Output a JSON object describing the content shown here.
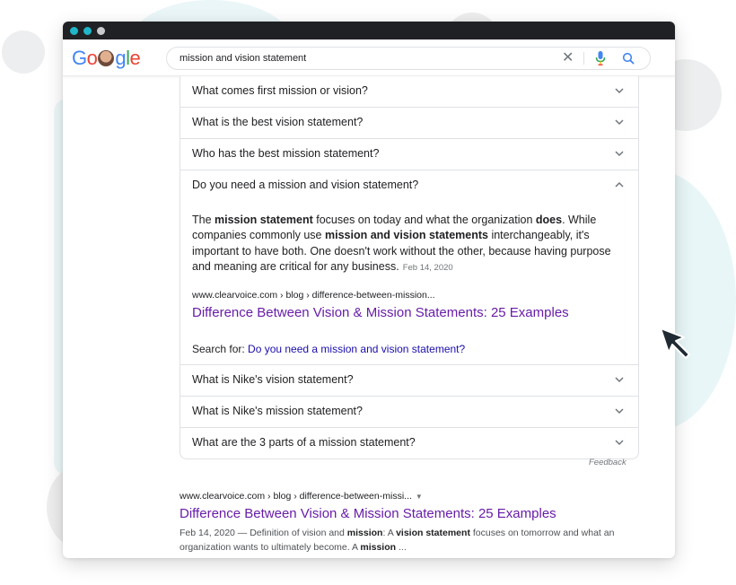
{
  "browser": {
    "logo_text": "Google"
  },
  "search": {
    "query": "mission and vision statement"
  },
  "paa": {
    "questions_before": [
      "What comes first mission or vision?",
      "What is the best vision statement?",
      "Who has the best mission statement?"
    ],
    "expanded": {
      "question": "Do you need a mission and vision statement?",
      "answer_parts": {
        "p1": "The ",
        "b1": "mission statement",
        "p2": " focuses on today and what the organization ",
        "b2": "does",
        "p3": ". While companies commonly use ",
        "b3": "mission and vision statements",
        "p4": " interchangeably, it's important to have both. One doesn't work without the other, because having purpose and meaning are critical for any business."
      },
      "date": "Feb 14, 2020",
      "source_url": "www.clearvoice.com › blog › difference-between-mission...",
      "source_title": "Difference Between Vision & Mission Statements: 25 Examples",
      "search_for_label": "Search for: ",
      "search_for_link": "Do you need a mission and vision statement?"
    },
    "questions_after": [
      "What is Nike's vision statement?",
      "What is Nike's mission statement?",
      "What are the 3 parts of a mission statement?"
    ],
    "feedback_label": "Feedback"
  },
  "result": {
    "url": "www.clearvoice.com › blog › difference-between-missi...",
    "title": "Difference Between Vision & Mission Statements: 25 Examples",
    "snippet": {
      "s1": "Feb 14, 2020 — Definition of vision and ",
      "b1": "mission",
      "s2": ": A ",
      "b2": "vision statement",
      "s3": " focuses on tomorrow and what an organization wants to ultimately become. A ",
      "b3": "mission",
      "s4": " ..."
    }
  },
  "colors": {
    "link_visited": "#681da8",
    "link": "#1a0dab",
    "accent_dots": "#1fb6c9"
  },
  "icons": [
    "clear-icon",
    "mic-icon",
    "search-icon",
    "chevron-down-icon",
    "chevron-up-icon",
    "cursor-arrow-icon",
    "dropdown-triangle-icon"
  ]
}
